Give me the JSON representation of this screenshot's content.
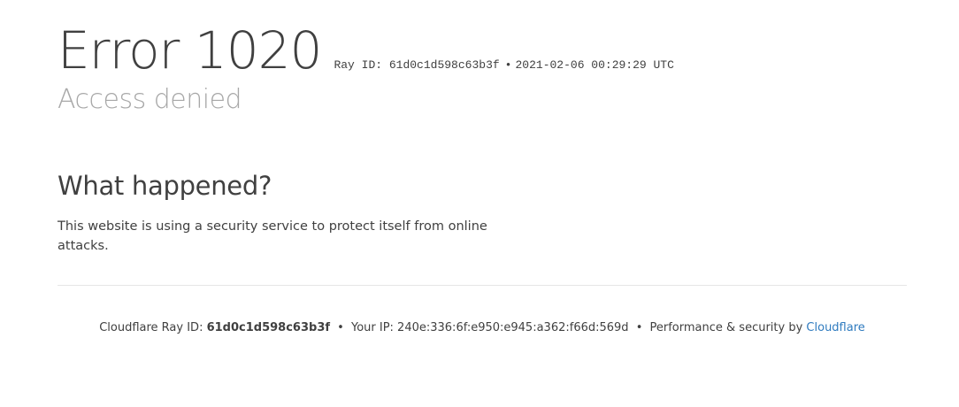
{
  "header": {
    "error_title": "Error 1020",
    "ray_id_label": "Ray ID: 61d0c1d598c63b3f",
    "bullet": "•",
    "timestamp": "2021-02-06 00:29:29 UTC",
    "subtitle": "Access denied"
  },
  "section": {
    "heading": "What happened?",
    "body": "This website is using a security service to protect itself from online attacks."
  },
  "footer": {
    "ray_label": "Cloudflare Ray ID: ",
    "ray_value": "61d0c1d598c63b3f",
    "separator": "•",
    "ip_text": "Your IP: 240e:336:6f:e950:e945:a362:f66d:569d",
    "perf_text": "Performance & security by ",
    "link_text": "Cloudflare",
    "link_color": "#2f7bbf"
  }
}
